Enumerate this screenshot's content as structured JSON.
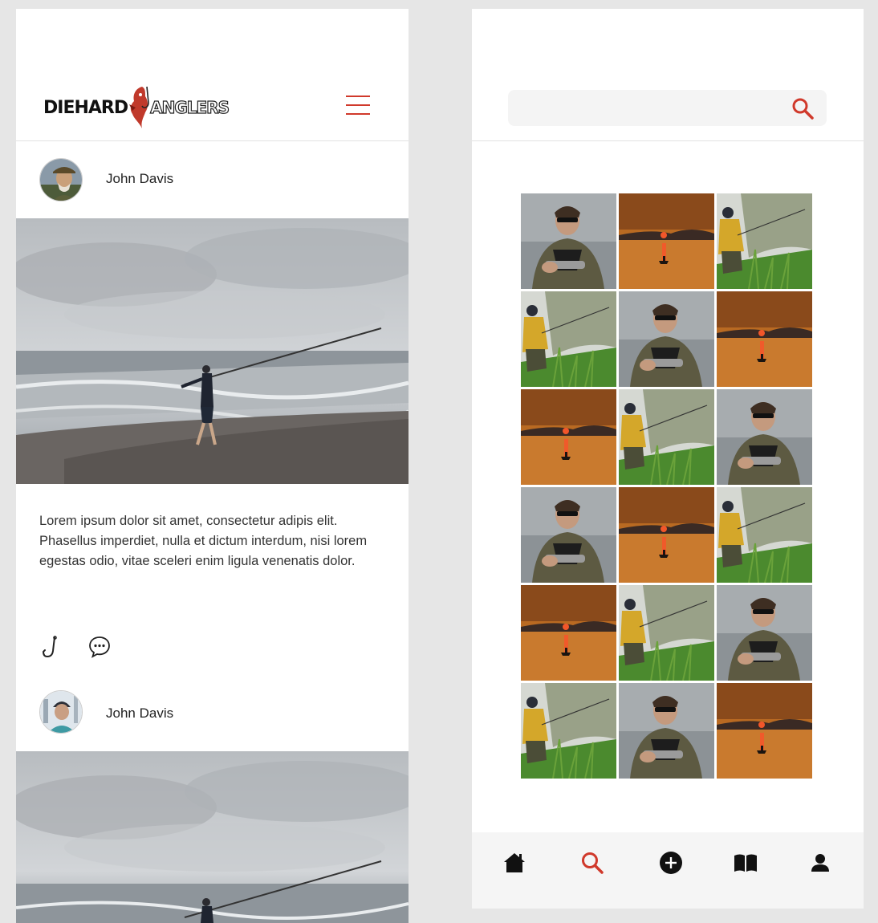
{
  "brand": {
    "logo_word_1": "Diehard",
    "logo_word_2": "Anglers",
    "accent_color": "#d0392b"
  },
  "feed": {
    "menu_icon": "hamburger-menu-icon",
    "posts": [
      {
        "author": "John Davis",
        "caption": "Lorem ipsum dolor sit amet, consectetur adipis elit. Phasellus imperdiet, nulla et dictum interdum, nisi lorem egestas odio, vitae sceleri enim ligula venenatis dolor.",
        "actions": [
          "hook-icon",
          "comment-icon"
        ]
      },
      {
        "author": "John Davis"
      }
    ]
  },
  "explore": {
    "search": {
      "placeholder": "",
      "value": ""
    },
    "grid_tiles": [
      "man-with-rod",
      "sunset-lake",
      "angler-yellow-jacket",
      "angler-yellow-jacket",
      "man-with-rod",
      "sunset-lake",
      "sunset-lake",
      "angler-yellow-jacket",
      "man-with-rod",
      "man-with-rod",
      "sunset-lake",
      "angler-yellow-jacket",
      "sunset-lake",
      "angler-yellow-jacket",
      "man-with-rod",
      "angler-yellow-jacket",
      "man-with-rod",
      "sunset-lake"
    ],
    "bottom_nav": {
      "items": [
        "home-icon",
        "search-icon",
        "add-icon",
        "book-icon",
        "profile-icon"
      ],
      "active": "search-icon"
    }
  }
}
